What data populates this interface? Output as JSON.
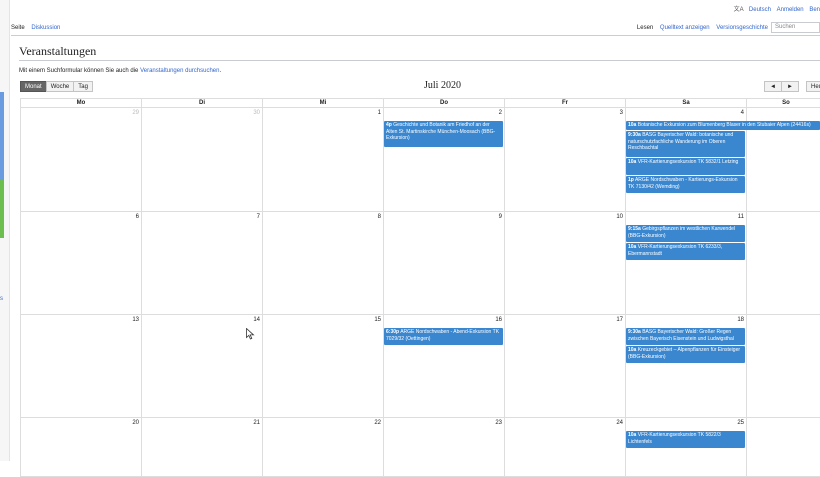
{
  "toplinks": {
    "language": "Deutsch",
    "login": "Anmelden",
    "register": "Ben"
  },
  "tabs": {
    "left": [
      "Seite",
      "Diskussion"
    ],
    "right": [
      "Lesen",
      "Quelltext anzeigen",
      "Versionsgeschichte"
    ]
  },
  "search": {
    "placeholder": "Suchen"
  },
  "page": {
    "title": "Veranstaltungen",
    "intro_text": "Mit einem Suchformular können Sie auch die ",
    "intro_link": "Veranstaltungen durchsuchen",
    "intro_end": "."
  },
  "calendar": {
    "views": [
      "Monat",
      "Woche",
      "Tag"
    ],
    "active_view": "Monat",
    "title": "Juli 2020",
    "prev": "◄",
    "next": "►",
    "today": "Heu",
    "weekdays": [
      "Mo",
      "Di",
      "Mi",
      "Do",
      "Fr",
      "Sa",
      "So"
    ],
    "weeks": [
      [
        "29",
        "30",
        "1",
        "2",
        "3",
        "4",
        ""
      ],
      [
        "6",
        "7",
        "8",
        "9",
        "10",
        "11",
        ""
      ],
      [
        "13",
        "14",
        "15",
        "16",
        "17",
        "18",
        ""
      ],
      [
        "20",
        "21",
        "22",
        "23",
        "24",
        "25",
        ""
      ]
    ],
    "events": [
      {
        "time": "4p",
        "text": "Geschichte und Botanik am Friedhof an der Alten St. Martinskirche München-Moosach (BBG-Exkursion)"
      },
      {
        "time": "10a",
        "text": "Botanische Exkursion zum Blumenberg Blaser in den Stubaier Alpen (24416s)"
      },
      {
        "time": "9:30a",
        "text": "BASG Bayerischer Wald: botanische und naturschutzfachliche Wanderung im Oberen Reschbachtal"
      },
      {
        "time": "10a",
        "text": "VFR-Kartierungsexkursion TK 5832/1 Letzing"
      },
      {
        "time": "1p",
        "text": "ARGE Nordschwaben - Kartierungs-Exkursion TK 7130/42 (Wemding)"
      },
      {
        "time": "9:15a",
        "text": "Gebirgspflanzen im westlichen Karwendel (BBG-Exkursion)"
      },
      {
        "time": "10a",
        "text": "VFR-Kartierungsexkursion TK 6233/3, Ebermannstadt"
      },
      {
        "time": "6:30p",
        "text": "ARGE Nordschwaben - Abend-Exkursion TK 7029/32 (Oettingen)"
      },
      {
        "time": "9:30a",
        "text": "BASG Bayerischer Wald: Großer Regen zwischen Bayerisch Eisenstein und Ludwigsthal"
      },
      {
        "time": "10a",
        "text": "Kreuzeckgebiet – Alpenpflanzen für Einsteiger (BBG-Exkursion)"
      },
      {
        "time": "10a",
        "text": "VFR-Kartierungsexkursion TK 5822/3 Lichtenfels"
      }
    ]
  }
}
